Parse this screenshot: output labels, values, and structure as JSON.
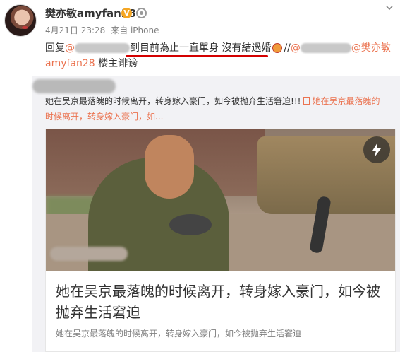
{
  "post": {
    "username": "樊亦敏amyfan28",
    "vip_badge": "V",
    "time": "4月21日 23:28",
    "source": "来自 iPhone",
    "reply_prefix": "回复",
    "at_sign": "@",
    "highlighted_text": "到目前為止一直單身 沒有結過婚",
    "separator": "//",
    "mention_tail": "@樊亦敏",
    "mention_line2": "amyfan28",
    "line2_text": " 楼主诽谤"
  },
  "repost": {
    "text1": "她在吴京最落魄的时候离开，转身嫁入豪门，如今被抛弃生活窘迫!!!",
    "link_text": "她在吴京最落魄的",
    "link_text2": "时候离开，转身嫁入豪门，如..."
  },
  "card": {
    "title": "她在吴京最落魄的时候离开，转身嫁入豪门，如今被抛弃生活窘迫",
    "description": "她在吴京最落魄的时候离开，转身嫁入豪门，如今被抛弃生活窘迫"
  },
  "icons": {
    "chevron": "chevron-down-icon",
    "flash": "lightning-icon"
  },
  "colors": {
    "mention": "#eb7350",
    "underline": "#d40000",
    "repost_bg": "#f2f2f5"
  }
}
